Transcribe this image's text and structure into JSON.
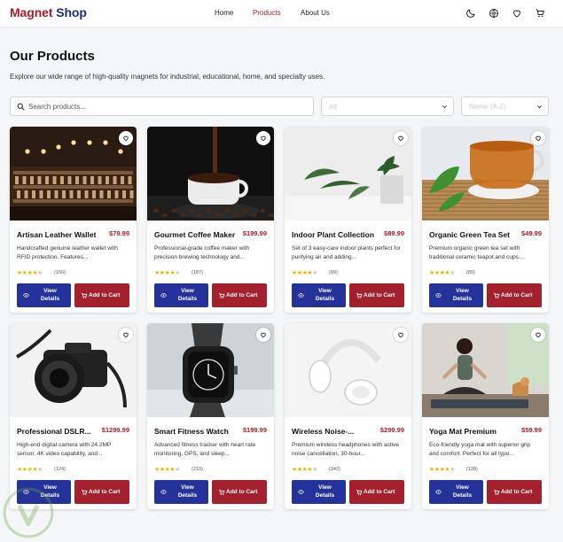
{
  "header": {
    "brand_part1": "Magnet",
    "brand_part2": "Shop",
    "nav": [
      {
        "label": "Home",
        "active": false
      },
      {
        "label": "Products",
        "active": true
      },
      {
        "label": "About Us",
        "active": false
      }
    ],
    "icons": [
      "moon-icon",
      "globe-icon",
      "heart-icon",
      "cart-icon"
    ]
  },
  "page": {
    "title": "Our Products",
    "subtitle": "Explore our wide range of high-quality magnets for industrial, educational, home, and specialty uses."
  },
  "filters": {
    "search_placeholder": "Search products...",
    "category_value": "All",
    "sort_value": "Name (A-Z)"
  },
  "actions": {
    "view_label": "View Details",
    "cart_label": "Add to Cart"
  },
  "colors": {
    "brand_red": "#a51e2a",
    "brand_blue": "#1e2a8a",
    "view_button": "#25329a",
    "cart_button": "#a3202c",
    "star": "#f0b400"
  },
  "products": [
    {
      "name": "Artisan Leather Wallet",
      "price": "$79.99",
      "description": "Handcrafted genuine leather wallet with RFID protection. Features...",
      "rating": 4,
      "reviews": "(156)"
    },
    {
      "name": "Gourmet Coffee Maker",
      "price": "$199.99",
      "description": "Professional-grade coffee maker with precision brewing technology and...",
      "rating": 4,
      "reviews": "(187)"
    },
    {
      "name": "Indoor Plant Collection",
      "price": "$89.99",
      "description": "Set of 3 easy-care indoor plants perfect for purifying air and adding...",
      "rating": 4,
      "reviews": "(89)"
    },
    {
      "name": "Organic Green Tea Set",
      "price": "$49.99",
      "description": "Premium organic green tea set with traditional ceramic teapot and cups....",
      "rating": 4,
      "reviews": "(89)"
    },
    {
      "name": "Professional DSLR...",
      "price": "$1299.99",
      "description": "High-end digital camera with 24.2MP sensor, 4K video capability, and...",
      "rating": 4,
      "reviews": "(124)"
    },
    {
      "name": "Smart Fitness Watch",
      "price": "$199.99",
      "description": "Advanced fitness tracker with heart rate monitoring, GPS, and sleep...",
      "rating": 4,
      "reviews": "(210)"
    },
    {
      "name": "Wireless Noise-...",
      "price": "$299.99",
      "description": "Premium wireless headphones with active noise cancellation, 30-hour...",
      "rating": 4,
      "reviews": "(342)"
    },
    {
      "name": "Yoga Mat Premium",
      "price": "$59.99",
      "description": "Eco-friendly yoga mat with superior grip and comfort. Perfect for all typo...",
      "rating": 4,
      "reviews": "(128)"
    }
  ]
}
